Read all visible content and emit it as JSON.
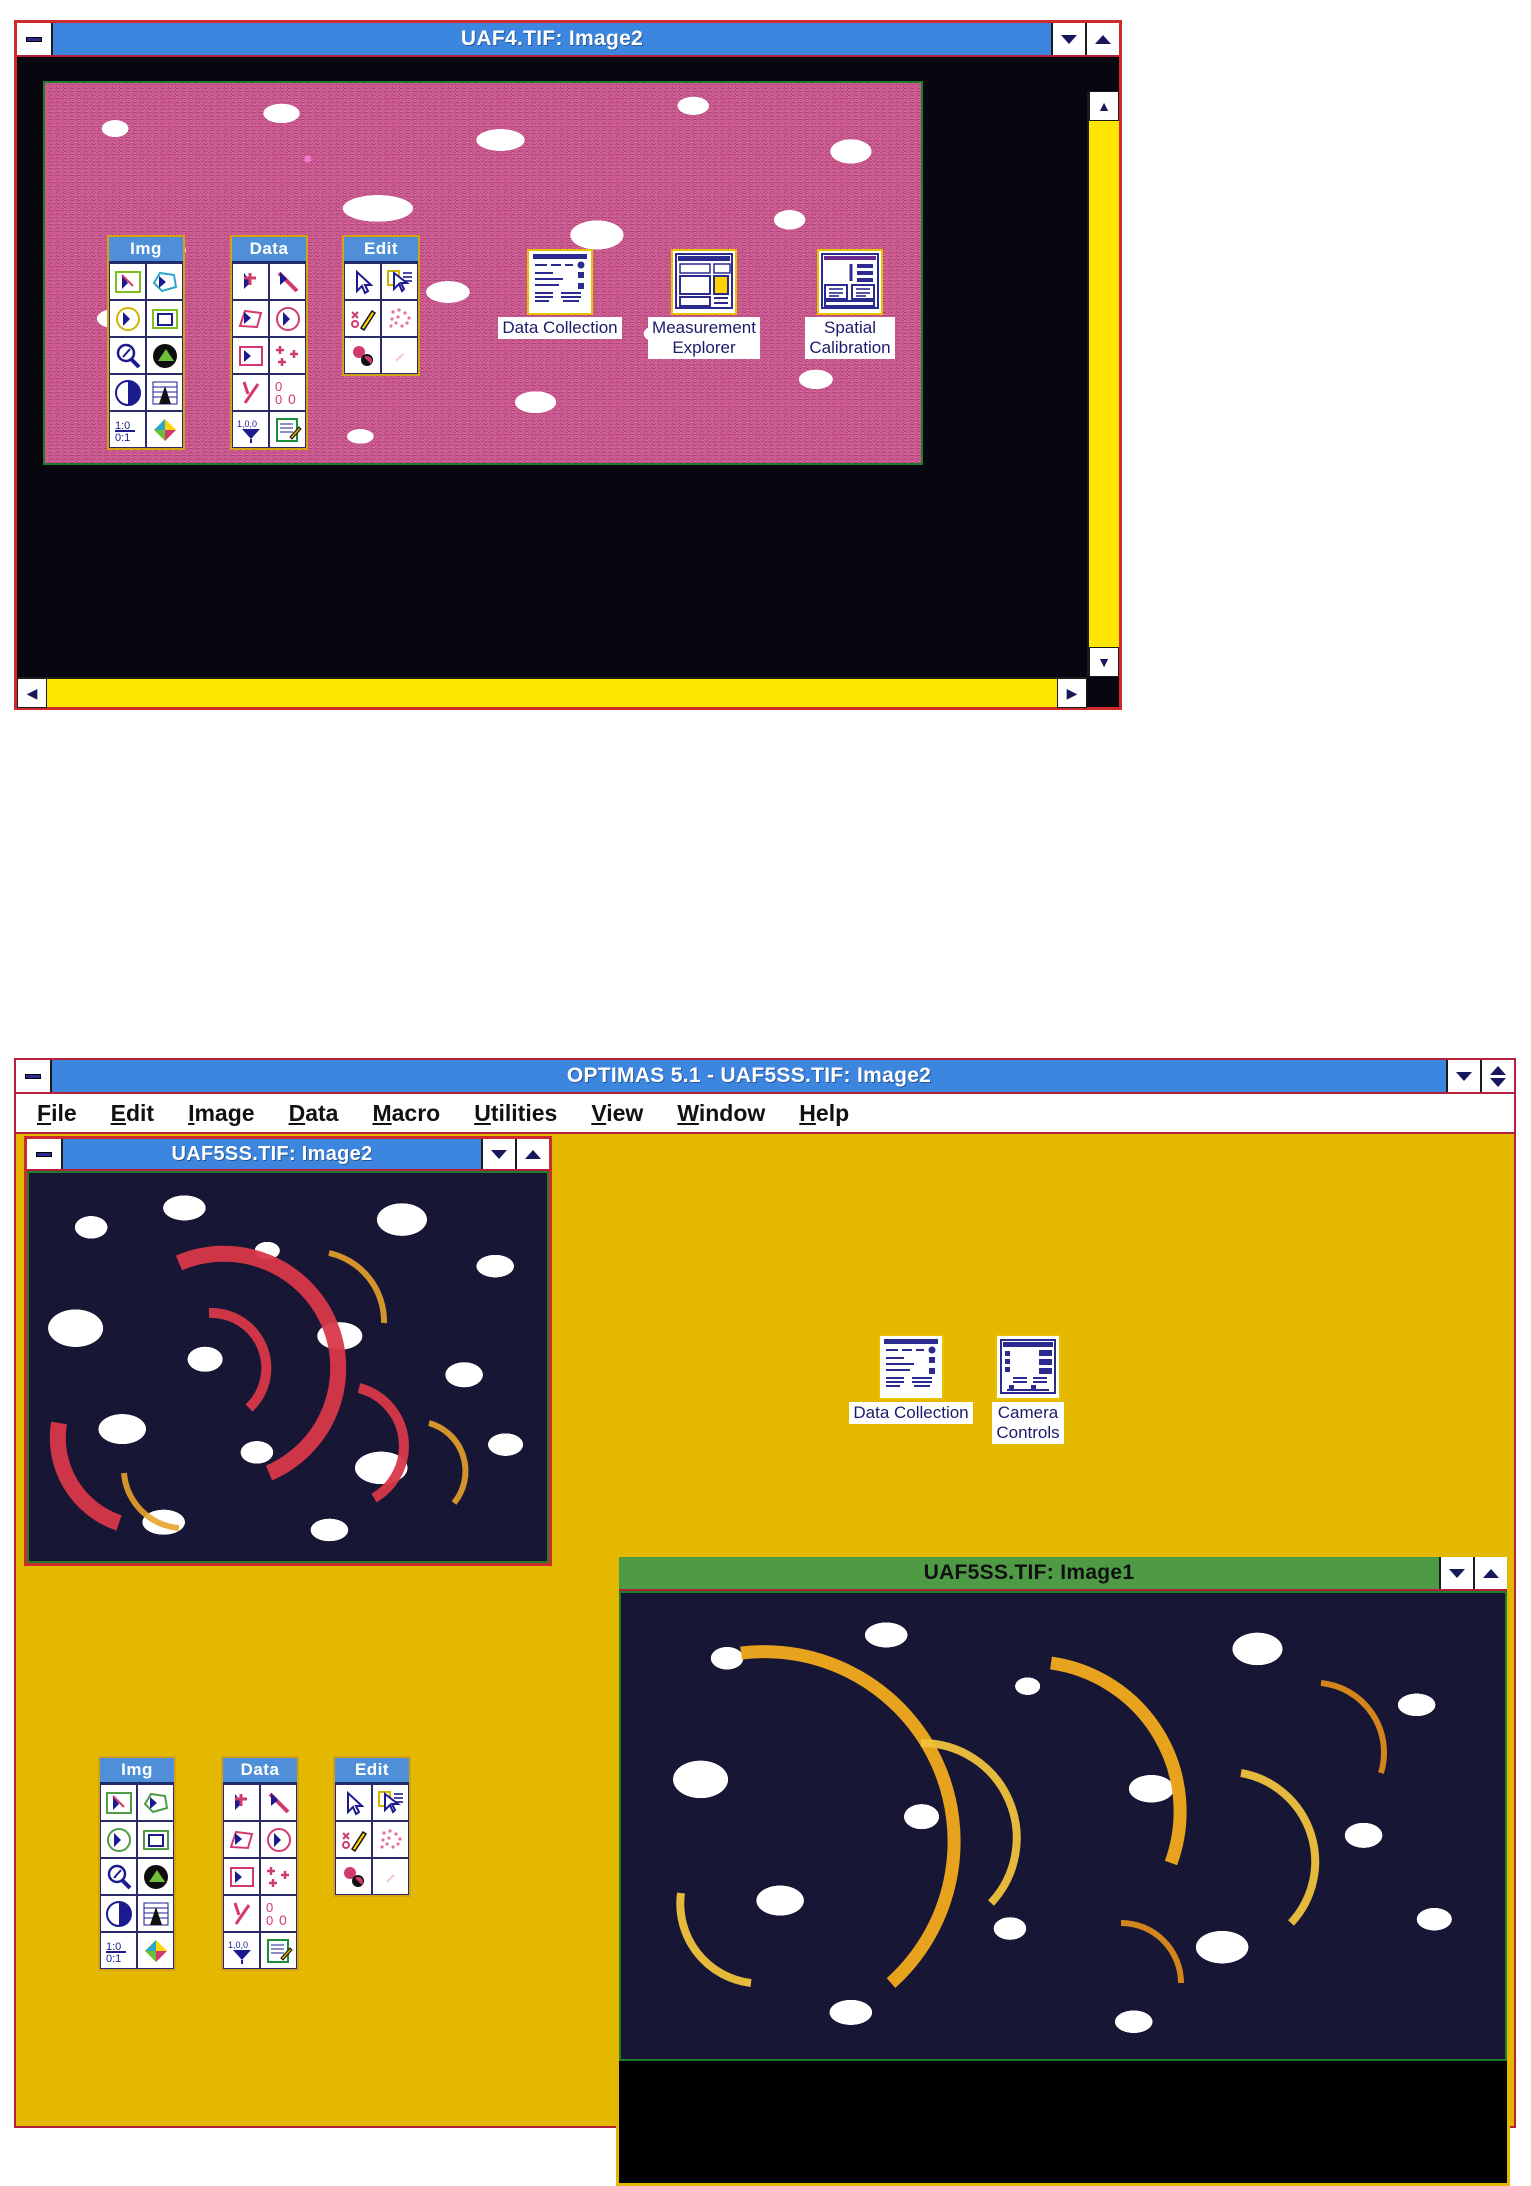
{
  "app": {
    "name": "OPTIMAS 5.1",
    "title": "OPTIMAS 5.1  - UAF5SS.TIF: Image2",
    "menu": [
      {
        "label": "File",
        "mnemonic": "F"
      },
      {
        "label": "Edit",
        "mnemonic": "E"
      },
      {
        "label": "Image",
        "mnemonic": "I"
      },
      {
        "label": "Data",
        "mnemonic": "D"
      },
      {
        "label": "Macro",
        "mnemonic": "M"
      },
      {
        "label": "Utilities",
        "mnemonic": "U"
      },
      {
        "label": "View",
        "mnemonic": "V"
      },
      {
        "label": "Window",
        "mnemonic": "W"
      },
      {
        "label": "Help",
        "mnemonic": "H"
      }
    ]
  },
  "top_window": {
    "title": "UAF4.TIF: Image2",
    "state": "active",
    "titlebar_color": "#3d86e0",
    "frame_color": "#cc2b2b",
    "client_color": "#07070f",
    "scrollbar_color": "#ffe600",
    "image_name": "UAF4.TIF",
    "image_border_color": "#1d7d2c"
  },
  "doc_image2": {
    "title": "UAF5SS.TIF: Image2",
    "state": "active",
    "titlebar_color": "#3d86e0",
    "frame_color": "#cc2b2b"
  },
  "doc_image1": {
    "title": "UAF5SS.TIF: Image1",
    "state": "inactive",
    "titlebar_color": "#4f9b45",
    "frame_color": "#e5b800"
  },
  "desktop": {
    "background_color": "#e5b800"
  },
  "palettes": {
    "img": {
      "title": "Img",
      "title_color": "#4f8fd8",
      "tools": [
        "arrow-in-rectangle-icon",
        "arrow-in-polygon-icon",
        "arrow-in-circle-icon",
        "filled-rectangle-icon",
        "magnifier-icon",
        "contrast-sphere-icon",
        "half-circle-icon",
        "histogram-mountain-icon",
        "one-to-one-icon",
        "color-palette-icon"
      ]
    },
    "data": {
      "title": "Data",
      "title_color": "#4f8fd8",
      "tools": [
        "point-measure-icon",
        "line-measure-icon",
        "polygon-area-icon",
        "circle-area-icon",
        "rect-area-icon",
        "multi-point-icon",
        "angle-icon",
        "count-icon",
        "calibrate-icon",
        "notepad-icon"
      ]
    },
    "edit": {
      "title": "Edit",
      "title_color": "#4f8fd8",
      "tools": [
        "pointer-icon",
        "select-region-icon",
        "pencil-edit-icon",
        "speckle-icon",
        "paint-blob-icon",
        "blank-icon"
      ]
    }
  },
  "program_icons": {
    "top_window": [
      {
        "label": "Data Collection",
        "icon": "document-list-icon"
      },
      {
        "label": "Measurement\nExplorer",
        "icon": "window-panes-icon"
      },
      {
        "label": "Spatial\nCalibration",
        "icon": "calibration-form-icon"
      }
    ],
    "app_window": [
      {
        "label": "Data Collection",
        "icon": "document-list-icon"
      },
      {
        "label": "Camera\nControls",
        "icon": "camera-panel-icon"
      }
    ]
  },
  "window_buttons": {
    "minimize": "minimize-icon",
    "maximize": "maximize-icon",
    "system": "system-menu-icon"
  }
}
